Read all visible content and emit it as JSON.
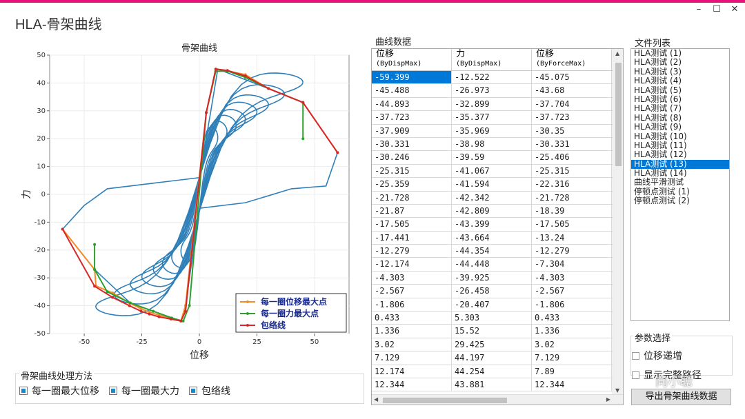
{
  "window": {
    "title": "HLA-骨架曲线",
    "controls": [
      "–",
      "☐",
      "✕"
    ]
  },
  "chart_data": {
    "type": "line",
    "title": "骨架曲线",
    "xlabel": "位移",
    "ylabel": "力",
    "xlim": [
      -65,
      65
    ],
    "ylim": [
      -50,
      50
    ],
    "xticks": [
      -50,
      -25,
      0,
      25,
      50
    ],
    "yticks": [
      -50,
      -40,
      -30,
      -20,
      -10,
      0,
      10,
      20,
      30,
      40,
      50
    ],
    "grid": true,
    "legend_position": "bottom-right",
    "series": [
      {
        "name": "每一圈位移最大点",
        "color": "#f28c28",
        "x": [
          -59.4,
          -45.5,
          -44.9,
          -37.7,
          -30.3,
          -25.3,
          -21.7,
          -17.5,
          -12.3,
          -8.0,
          -6.0,
          3.0,
          7.1,
          12.2,
          20.0,
          30.0,
          45.0,
          60.0
        ],
        "y": [
          -12.5,
          -27.0,
          -32.9,
          -35.4,
          -39.0,
          -41.1,
          -42.3,
          -43.4,
          -44.4,
          -45.5,
          -39.9,
          29.4,
          44.2,
          44.3,
          43.0,
          38.0,
          33.0,
          15.0
        ]
      },
      {
        "name": "每一圈力最大点",
        "color": "#2ca02c",
        "x": [
          -45.5,
          -45.5,
          -40.0,
          -30.0,
          -20.0,
          -12.0,
          -7.0,
          -4.3,
          3.0,
          7.1,
          12.2,
          20.0,
          30.0,
          45.0,
          45.0
        ],
        "y": [
          -18.0,
          -27.0,
          -35.0,
          -39.0,
          -42.0,
          -44.4,
          -45.5,
          -39.9,
          29.4,
          44.2,
          44.3,
          42.0,
          38.0,
          33.0,
          20.0
        ]
      },
      {
        "name": "包络线",
        "color": "#d62728",
        "x": [
          -59.4,
          -45.5,
          -37.7,
          -30.3,
          -25.3,
          -21.7,
          -17.5,
          -12.3,
          -8.0,
          -6.0,
          3.0,
          7.1,
          12.2,
          20.0,
          30.0,
          45.0,
          60.0
        ],
        "y": [
          -12.5,
          -33.0,
          -37.0,
          -40.0,
          -42.0,
          -43.0,
          -44.0,
          -44.8,
          -45.5,
          -42.0,
          29.4,
          45.0,
          44.5,
          42.5,
          38.0,
          33.0,
          15.0
        ]
      }
    ],
    "hysteresis_color": "#2f7fb8"
  },
  "method_group": {
    "title": "骨架曲线处理方法",
    "options": [
      {
        "label": "每一圈最大位移",
        "checked": true
      },
      {
        "label": "每一圈最大力",
        "checked": true
      },
      {
        "label": "包络线",
        "checked": true
      }
    ]
  },
  "table": {
    "title": "曲线数据",
    "columns": [
      {
        "label": "位移",
        "sub": "(ByDispMax)"
      },
      {
        "label": "力",
        "sub": "(ByDispMax)"
      },
      {
        "label": "位移",
        "sub": "(ByForceMax)"
      }
    ],
    "rows": [
      [
        "-59.399",
        "-12.522",
        "-45.075"
      ],
      [
        "-45.488",
        "-26.973",
        "-43.68"
      ],
      [
        "-44.893",
        "-32.899",
        "-37.704"
      ],
      [
        "-37.723",
        "-35.377",
        "-37.723"
      ],
      [
        "-37.909",
        "-35.969",
        "-30.35"
      ],
      [
        "-30.331",
        "-38.98",
        "-30.331"
      ],
      [
        "-30.246",
        "-39.59",
        "-25.406"
      ],
      [
        "-25.315",
        "-41.067",
        "-25.315"
      ],
      [
        "-25.359",
        "-41.594",
        "-22.316"
      ],
      [
        "-21.728",
        "-42.342",
        "-21.728"
      ],
      [
        "-21.87",
        "-42.809",
        "-18.39"
      ],
      [
        "-17.505",
        "-43.399",
        "-17.505"
      ],
      [
        "-17.441",
        "-43.664",
        "-13.24"
      ],
      [
        "-12.279",
        "-44.354",
        "-12.279"
      ],
      [
        "-12.174",
        "-44.448",
        "-7.304"
      ],
      [
        "-4.303",
        "-39.925",
        "-4.303"
      ],
      [
        "-2.567",
        "-26.458",
        "-2.567"
      ],
      [
        "-1.806",
        "-20.407",
        "-1.806"
      ],
      [
        "0.433",
        "5.303",
        "0.433"
      ],
      [
        "1.336",
        "15.52",
        "1.336"
      ],
      [
        "3.02",
        "29.425",
        "3.02"
      ],
      [
        "7.129",
        "44.197",
        "7.129"
      ],
      [
        "12.174",
        "44.254",
        "7.89"
      ],
      [
        "12.344",
        "43.881",
        "12.344"
      ]
    ]
  },
  "file_list": {
    "title": "文件列表",
    "items": [
      "HLA测试 (1)",
      "HLA测试 (2)",
      "HLA测试 (3)",
      "HLA测试 (4)",
      "HLA测试 (5)",
      "HLA测试 (6)",
      "HLA测试 (7)",
      "HLA测试 (8)",
      "HLA测试 (9)",
      "HLA测试 (10)",
      "HLA测试 (11)",
      "HLA测试 (12)",
      "HLA测试 (13)",
      "HLA测试 (14)",
      "曲线平滑测试",
      "停顿点测试 (1)",
      "停顿点测试 (2)"
    ],
    "selected_index": 12
  },
  "params": {
    "title": "参数选择",
    "options": [
      {
        "label": "位移递增",
        "checked": false
      },
      {
        "label": "显示完整路径",
        "checked": false
      }
    ]
  },
  "export_button": "导出骨架曲线数据",
  "watermark": "向小聪"
}
